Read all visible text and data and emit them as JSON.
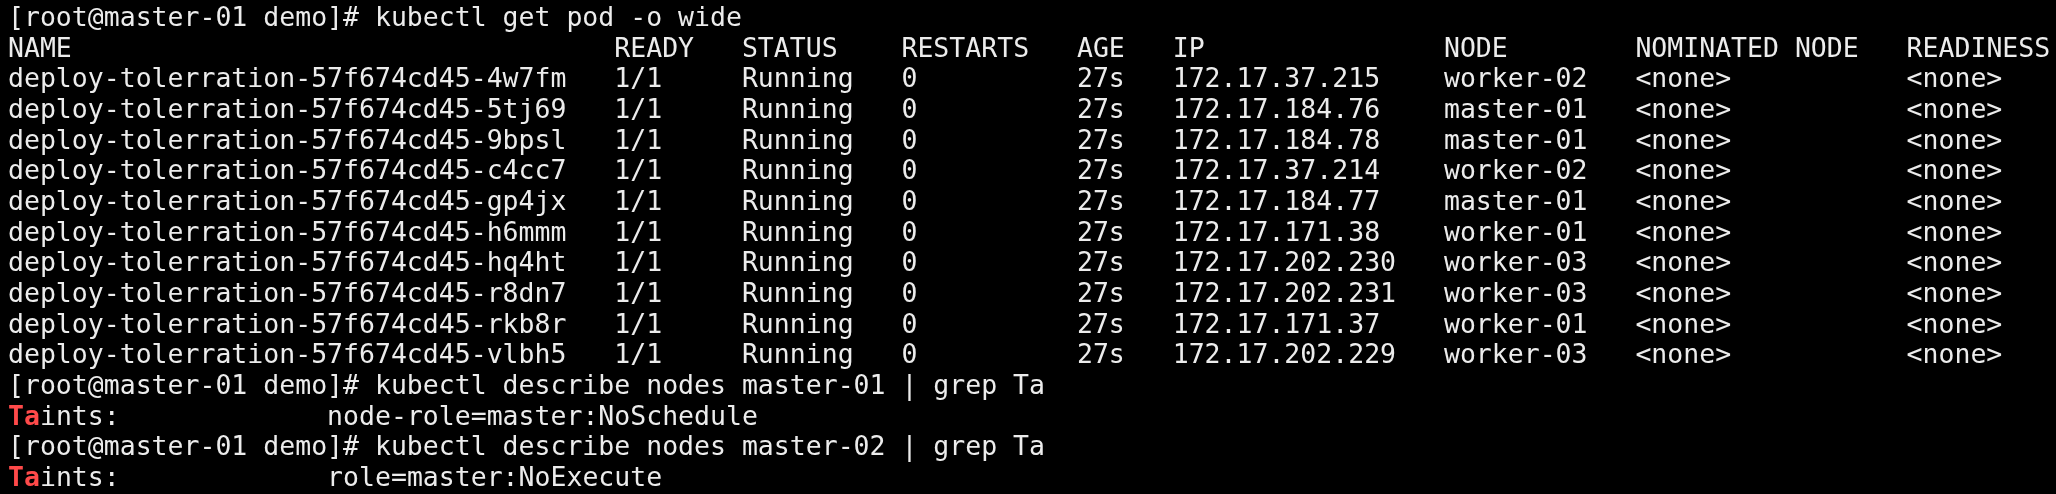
{
  "terminal": {
    "command_1": {
      "prompt": "[root@master-01 demo]#",
      "command": "kubectl get pod -o wide"
    },
    "table": {
      "columns": [
        "NAME",
        "READY",
        "STATUS",
        "RESTARTS",
        "AGE",
        "IP",
        "NODE",
        "NOMINATED NODE",
        "READINESS"
      ],
      "rows": [
        [
          "deploy-tolerration-57f674cd45-4w7fm",
          "1/1",
          "Running",
          "0",
          "27s",
          "172.17.37.215",
          "worker-02",
          "<none>",
          "<none>"
        ],
        [
          "deploy-tolerration-57f674cd45-5tj69",
          "1/1",
          "Running",
          "0",
          "27s",
          "172.17.184.76",
          "master-01",
          "<none>",
          "<none>"
        ],
        [
          "deploy-tolerration-57f674cd45-9bpsl",
          "1/1",
          "Running",
          "0",
          "27s",
          "172.17.184.78",
          "master-01",
          "<none>",
          "<none>"
        ],
        [
          "deploy-tolerration-57f674cd45-c4cc7",
          "1/1",
          "Running",
          "0",
          "27s",
          "172.17.37.214",
          "worker-02",
          "<none>",
          "<none>"
        ],
        [
          "deploy-tolerration-57f674cd45-gp4jx",
          "1/1",
          "Running",
          "0",
          "27s",
          "172.17.184.77",
          "master-01",
          "<none>",
          "<none>"
        ],
        [
          "deploy-tolerration-57f674cd45-h6mmm",
          "1/1",
          "Running",
          "0",
          "27s",
          "172.17.171.38",
          "worker-01",
          "<none>",
          "<none>"
        ],
        [
          "deploy-tolerration-57f674cd45-hq4ht",
          "1/1",
          "Running",
          "0",
          "27s",
          "172.17.202.230",
          "worker-03",
          "<none>",
          "<none>"
        ],
        [
          "deploy-tolerration-57f674cd45-r8dn7",
          "1/1",
          "Running",
          "0",
          "27s",
          "172.17.202.231",
          "worker-03",
          "<none>",
          "<none>"
        ],
        [
          "deploy-tolerration-57f674cd45-rkb8r",
          "1/1",
          "Running",
          "0",
          "27s",
          "172.17.171.37",
          "worker-01",
          "<none>",
          "<none>"
        ],
        [
          "deploy-tolerration-57f674cd45-vlbh5",
          "1/1",
          "Running",
          "0",
          "27s",
          "172.17.202.229",
          "worker-03",
          "<none>",
          "<none>"
        ]
      ]
    },
    "greps": [
      {
        "prompt": "[root@master-01 demo]#",
        "command": "kubectl describe nodes master-01 | grep Ta",
        "match": "Ta",
        "label_rest": "ints:",
        "value": "node-role=master:NoSchedule"
      },
      {
        "prompt": "[root@master-01 demo]#",
        "command": "kubectl describe nodes master-02 | grep Ta",
        "match": "Ta",
        "label_rest": "ints:",
        "value": "role=master:NoExecute"
      }
    ]
  }
}
